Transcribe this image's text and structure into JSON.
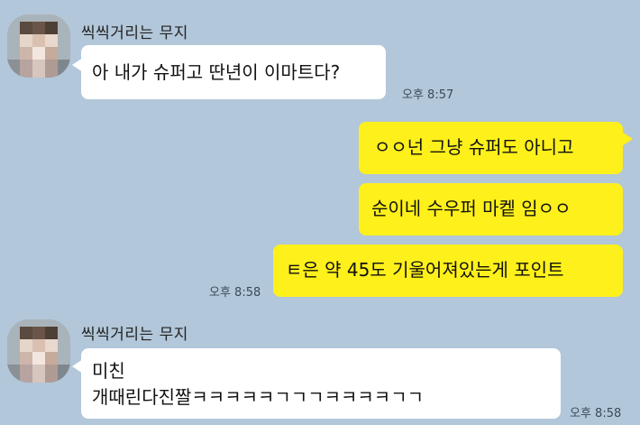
{
  "messages": [
    {
      "sender": "씩씩거리는 무지",
      "side": "left",
      "lines": [
        "아 내가 슈퍼고 딴년이 이마트다?"
      ],
      "time": "오후 8:57"
    },
    {
      "side": "right",
      "lines": [
        "ㅇㅇ넌 그냥 슈퍼도 아니고",
        "순이네 수우퍼 마켙 임ㅇㅇ",
        "ㅌ은 약 45도 기울어져있는게 포인트"
      ],
      "time": "오후 8:58"
    },
    {
      "sender": "씩씩거리는 무지",
      "side": "left",
      "lines": [
        "미친",
        "개때린다진짤ㅋㅋㅋㅋㅋㄱㄱㄱㅋㅋㅋㅋㄱㄱ"
      ],
      "time": "오후 8:58"
    }
  ],
  "colors": {
    "background": "#b2c7d9",
    "incoming_bubble": "#ffffff",
    "outgoing_bubble": "#fef01b"
  },
  "icons": {
    "avatar": "blurred-profile-avatar-icon"
  }
}
